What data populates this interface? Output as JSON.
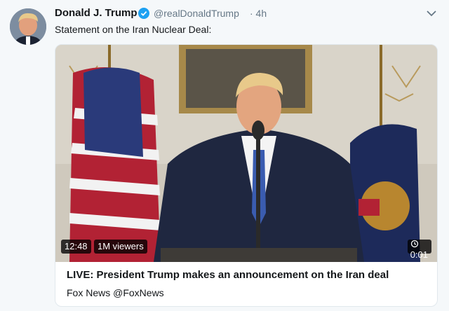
{
  "tweet": {
    "author_name": "Donald J. Trump",
    "handle": "@realDonaldTrump",
    "time": "· 4h",
    "text": "Statement on the Iran Nuclear Deal:",
    "verified": true
  },
  "card": {
    "duration": "12:48",
    "viewers": "1M viewers",
    "timer": "0:01",
    "title": "LIVE: President Trump makes an announcement on the Iran deal",
    "source": "Fox News @FoxNews"
  },
  "colors": {
    "verified_blue": "#1da1f2",
    "text_primary": "#14171a",
    "text_secondary": "#657786",
    "card_border": "#e1e8ed"
  },
  "icons": [
    "avatar",
    "verified-badge-icon",
    "chevron-down-icon",
    "clock-replay-icon"
  ]
}
